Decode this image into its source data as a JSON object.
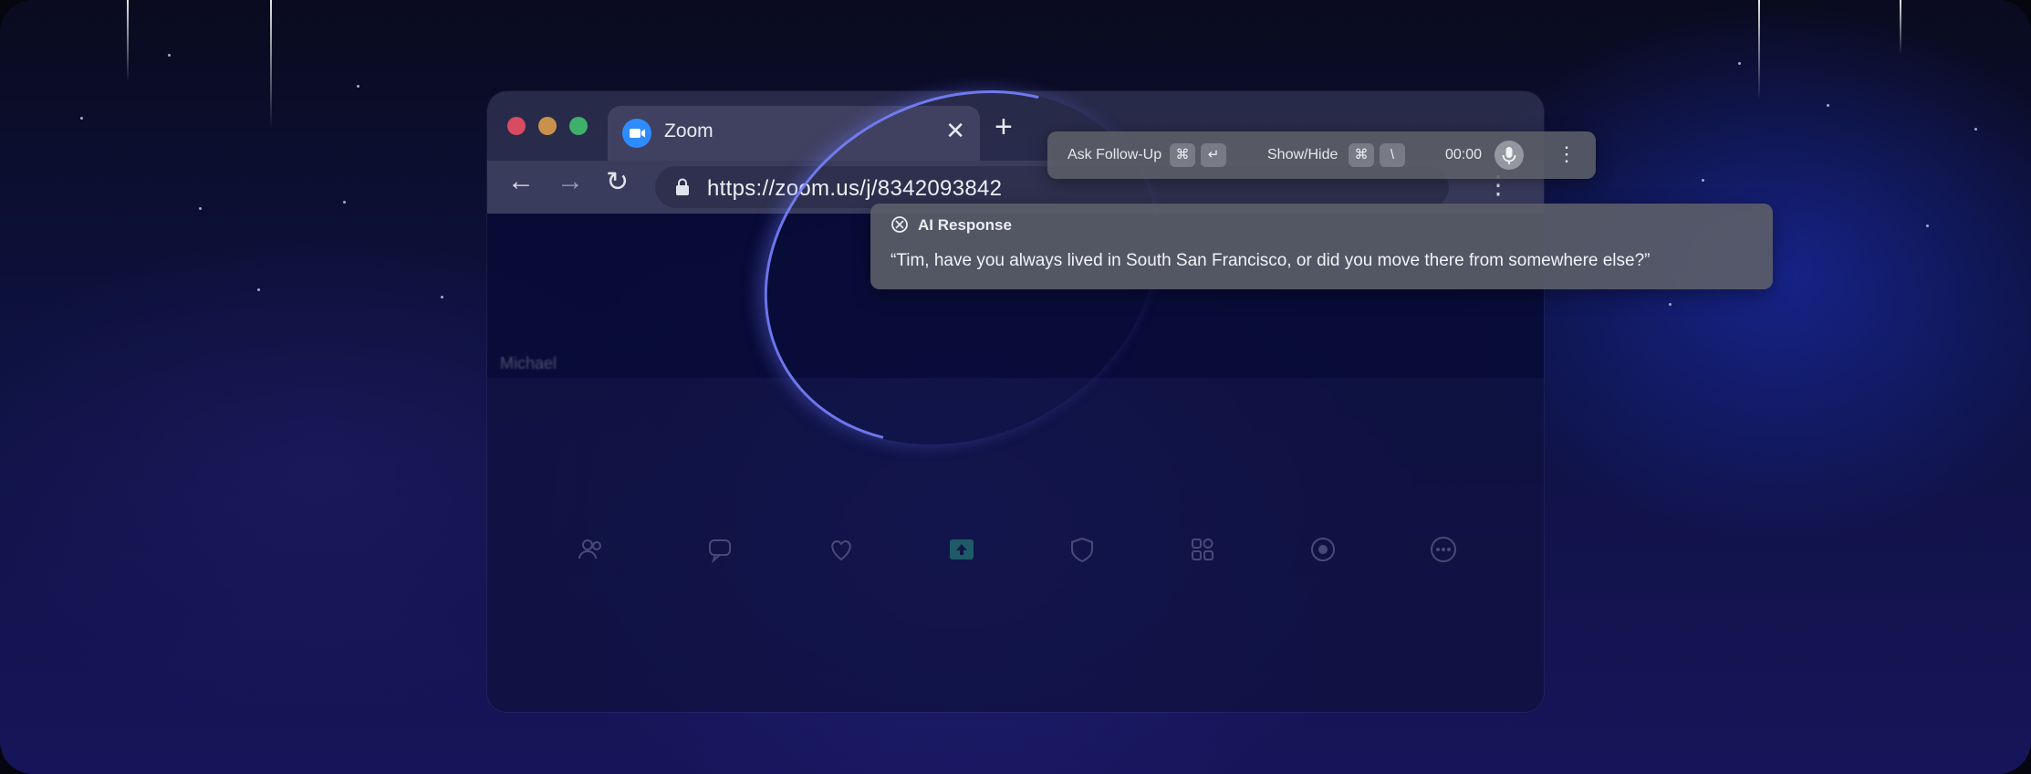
{
  "browser": {
    "tab": {
      "title": "Zoom",
      "favicon": "zoom-video-icon",
      "close_glyph": "✕"
    },
    "new_tab_glyph": "+",
    "nav": {
      "back_glyph": "←",
      "forward_glyph": "→",
      "reload_glyph": "↻"
    },
    "address_bar": {
      "url": "https://zoom.us/j/8342093842",
      "icon": "lock-icon"
    },
    "menu_glyph": "⋮"
  },
  "meeting": {
    "participant_name": "Michael"
  },
  "overlay_bar": {
    "ask_follow_up_label": "Ask Follow-Up",
    "ask_follow_up_keys": [
      "⌘",
      "↵"
    ],
    "show_hide_label": "Show/Hide",
    "show_hide_keys": [
      "⌘",
      "\\"
    ],
    "timer": "00:00",
    "mic_icon": "microphone-icon",
    "menu_glyph": "⋮"
  },
  "ai_response": {
    "title": "AI Response",
    "text": "“Tim, have you always lived in South San Francisco, or did you move there from somewhere else?”"
  },
  "colors": {
    "traffic_red": "#d94a63",
    "traffic_yellow": "#c8924c",
    "traffic_green": "#3fb06a",
    "zoom_blue": "#2d8cff"
  }
}
